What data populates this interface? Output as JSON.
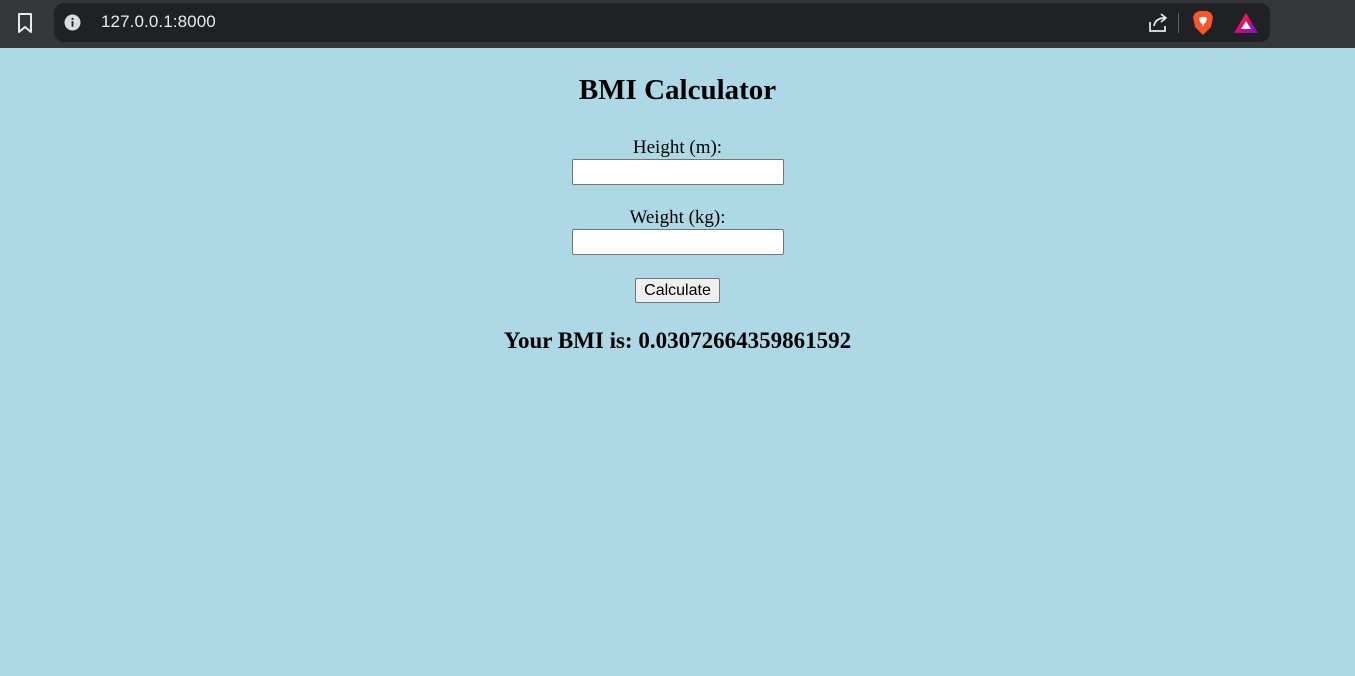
{
  "browser": {
    "url": "127.0.0.1:8000",
    "icons": {
      "bookmark": "bookmark-icon",
      "info": "info-icon",
      "share": "share-icon",
      "brave": "brave-shield-icon",
      "rewards": "brave-rewards-icon"
    }
  },
  "page": {
    "title": "BMI Calculator",
    "height_label": "Height (m):",
    "height_value": "",
    "weight_label": "Weight (kg):",
    "weight_value": "",
    "calculate_label": "Calculate",
    "result_text": "Your BMI is: 0.03072664359861592"
  },
  "colors": {
    "page_background": "#add8e6",
    "toolbar_background": "#35363a",
    "omnibox_background": "#202124",
    "brave_orange": "#fb542b"
  }
}
